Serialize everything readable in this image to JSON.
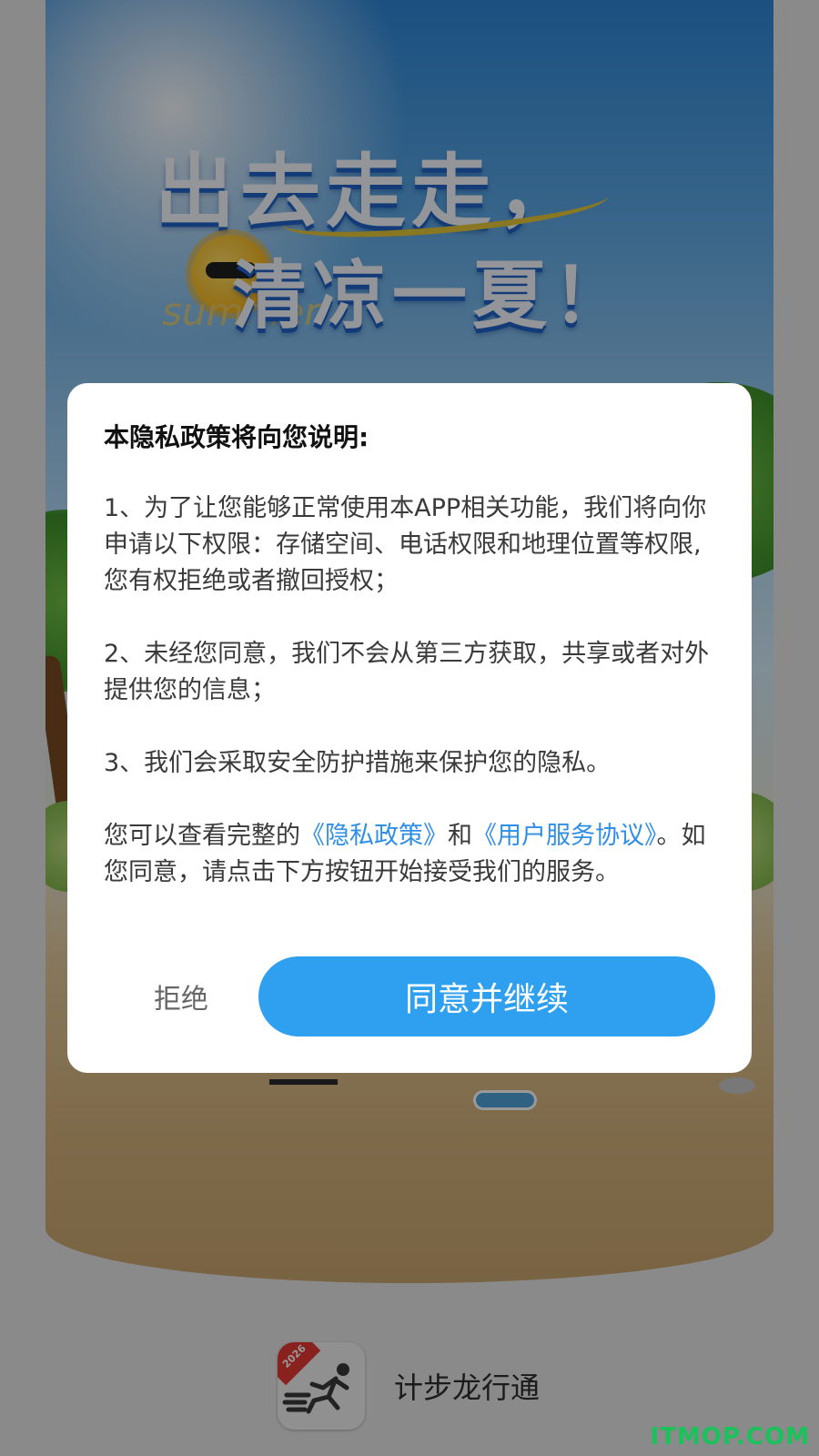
{
  "splash": {
    "headline_line1": "出去走走，",
    "headline_line2": "清凉一夏！",
    "summer_text": "summer"
  },
  "dialog": {
    "title": "本隐私政策将向您说明:",
    "point1": "1、为了让您能够正常使用本APP相关功能，我们将向你申请以下权限：存储空间、电话权限和地理位置等权限,您有权拒绝或者撤回授权；",
    "point2": "2、未经您同意，我们不会从第三方获取，共享或者对外提供您的信息；",
    "point3": "3、我们会采取安全防护措施来保护您的隐私。",
    "notice_prefix": "您可以查看完整的",
    "privacy_link": "《隐私政策》",
    "notice_and": "和",
    "service_link": "《用户服务协议》",
    "notice_suffix": "。如您同意，请点击下方按钮开始接受我们的服务。",
    "refuse_label": "拒绝",
    "agree_label": "同意并继续"
  },
  "brand": {
    "app_name": "计步龙行通",
    "icon_badge_year": "2026",
    "icon": "running-man-icon"
  },
  "watermark": "ITMOP.COM",
  "colors": {
    "accent": "#2fa0f0",
    "link": "#2f8fe6",
    "badge": "#e53935",
    "watermark": "#19c25a"
  }
}
